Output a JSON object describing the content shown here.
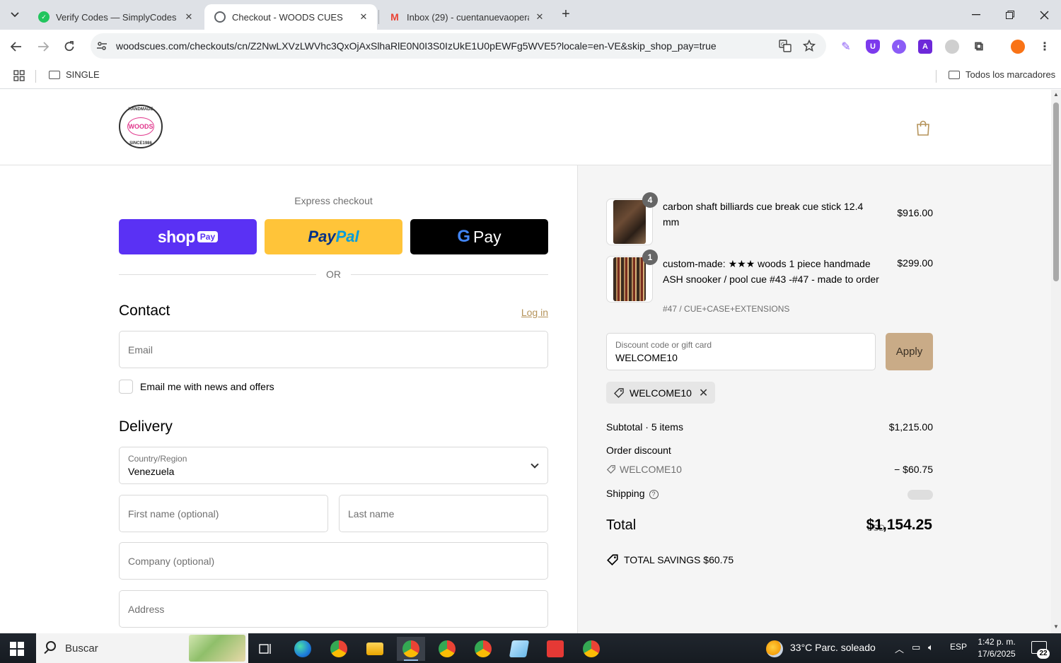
{
  "browser": {
    "tabs": [
      {
        "label": "Verify Codes — SimplyCodes",
        "icon": "simplycodes-favicon",
        "color": "#22c55e"
      },
      {
        "label": "Checkout - WOODS CUES",
        "icon": "globe-favicon",
        "color": "#5f6368"
      },
      {
        "label": "Inbox (29) - cuentanuevaoperac",
        "icon": "gmail-favicon",
        "color": "#ea4335"
      }
    ],
    "url": "woodscues.com/checkouts/cn/Z2NwLXVzLWVhc3QxOjAxSlhaRlE0N0I3S0IzUkE1U0pEWFg5WVE5?locale=en-VE&skip_shop_pay=true",
    "bookmarks": {
      "folder1": "SINGLE",
      "all": "Todos los marcadores"
    }
  },
  "brand": {
    "logo_text": "WOODS",
    "logo_top": "HANDMADE",
    "logo_bottom": "SINCE1986",
    "accent": "#b5935a"
  },
  "checkout": {
    "express_title": "Express checkout",
    "shoppay_word": "shop",
    "shoppay_pay": "Pay",
    "paypal_a": "Pay",
    "paypal_b": "Pal",
    "gpay_g": "G",
    "gpay_pay": "Pay",
    "or": "OR",
    "contact_title": "Contact",
    "login": "Log in",
    "email_placeholder": "Email",
    "newsletter_label": "Email me with news and offers",
    "delivery_title": "Delivery",
    "country_label": "Country/Region",
    "country_value": "Venezuela",
    "first_name_placeholder": "First name (optional)",
    "last_name_placeholder": "Last name",
    "company_placeholder": "Company (optional)",
    "address_placeholder": "Address"
  },
  "summary": {
    "items": [
      {
        "title": "carbon shaft billiards cue break cue stick 12.4 mm",
        "qty": "4",
        "price": "$916.00",
        "variant": ""
      },
      {
        "title": "custom-made: ★★★ woods 1 piece handmade ASH snooker / pool cue #43 -#47 - made to order",
        "qty": "1",
        "price": "$299.00",
        "variant": "#47 / CUE+CASE+EXTENSIONS"
      }
    ],
    "discount_label": "Discount code or gift card",
    "discount_value": "WELCOME10",
    "apply": "Apply",
    "applied_code": "WELCOME10",
    "subtotal_label": "Subtotal · 5 items",
    "subtotal_value": "$1,215.00",
    "order_discount_label": "Order discount",
    "order_discount_code": "WELCOME10",
    "order_discount_value": "− $60.75",
    "shipping_label": "Shipping",
    "total_label": "Total",
    "currency": "USD",
    "total_value": "$1,154.25",
    "savings_label": "TOTAL SAVINGS",
    "savings_value": "$60.75"
  },
  "taskbar": {
    "search": "Buscar",
    "weather": "33°C  Parc. soleado",
    "lang": "ESP",
    "time": "1:42 p. m.",
    "date": "17/6/2025",
    "notifications": "22"
  }
}
